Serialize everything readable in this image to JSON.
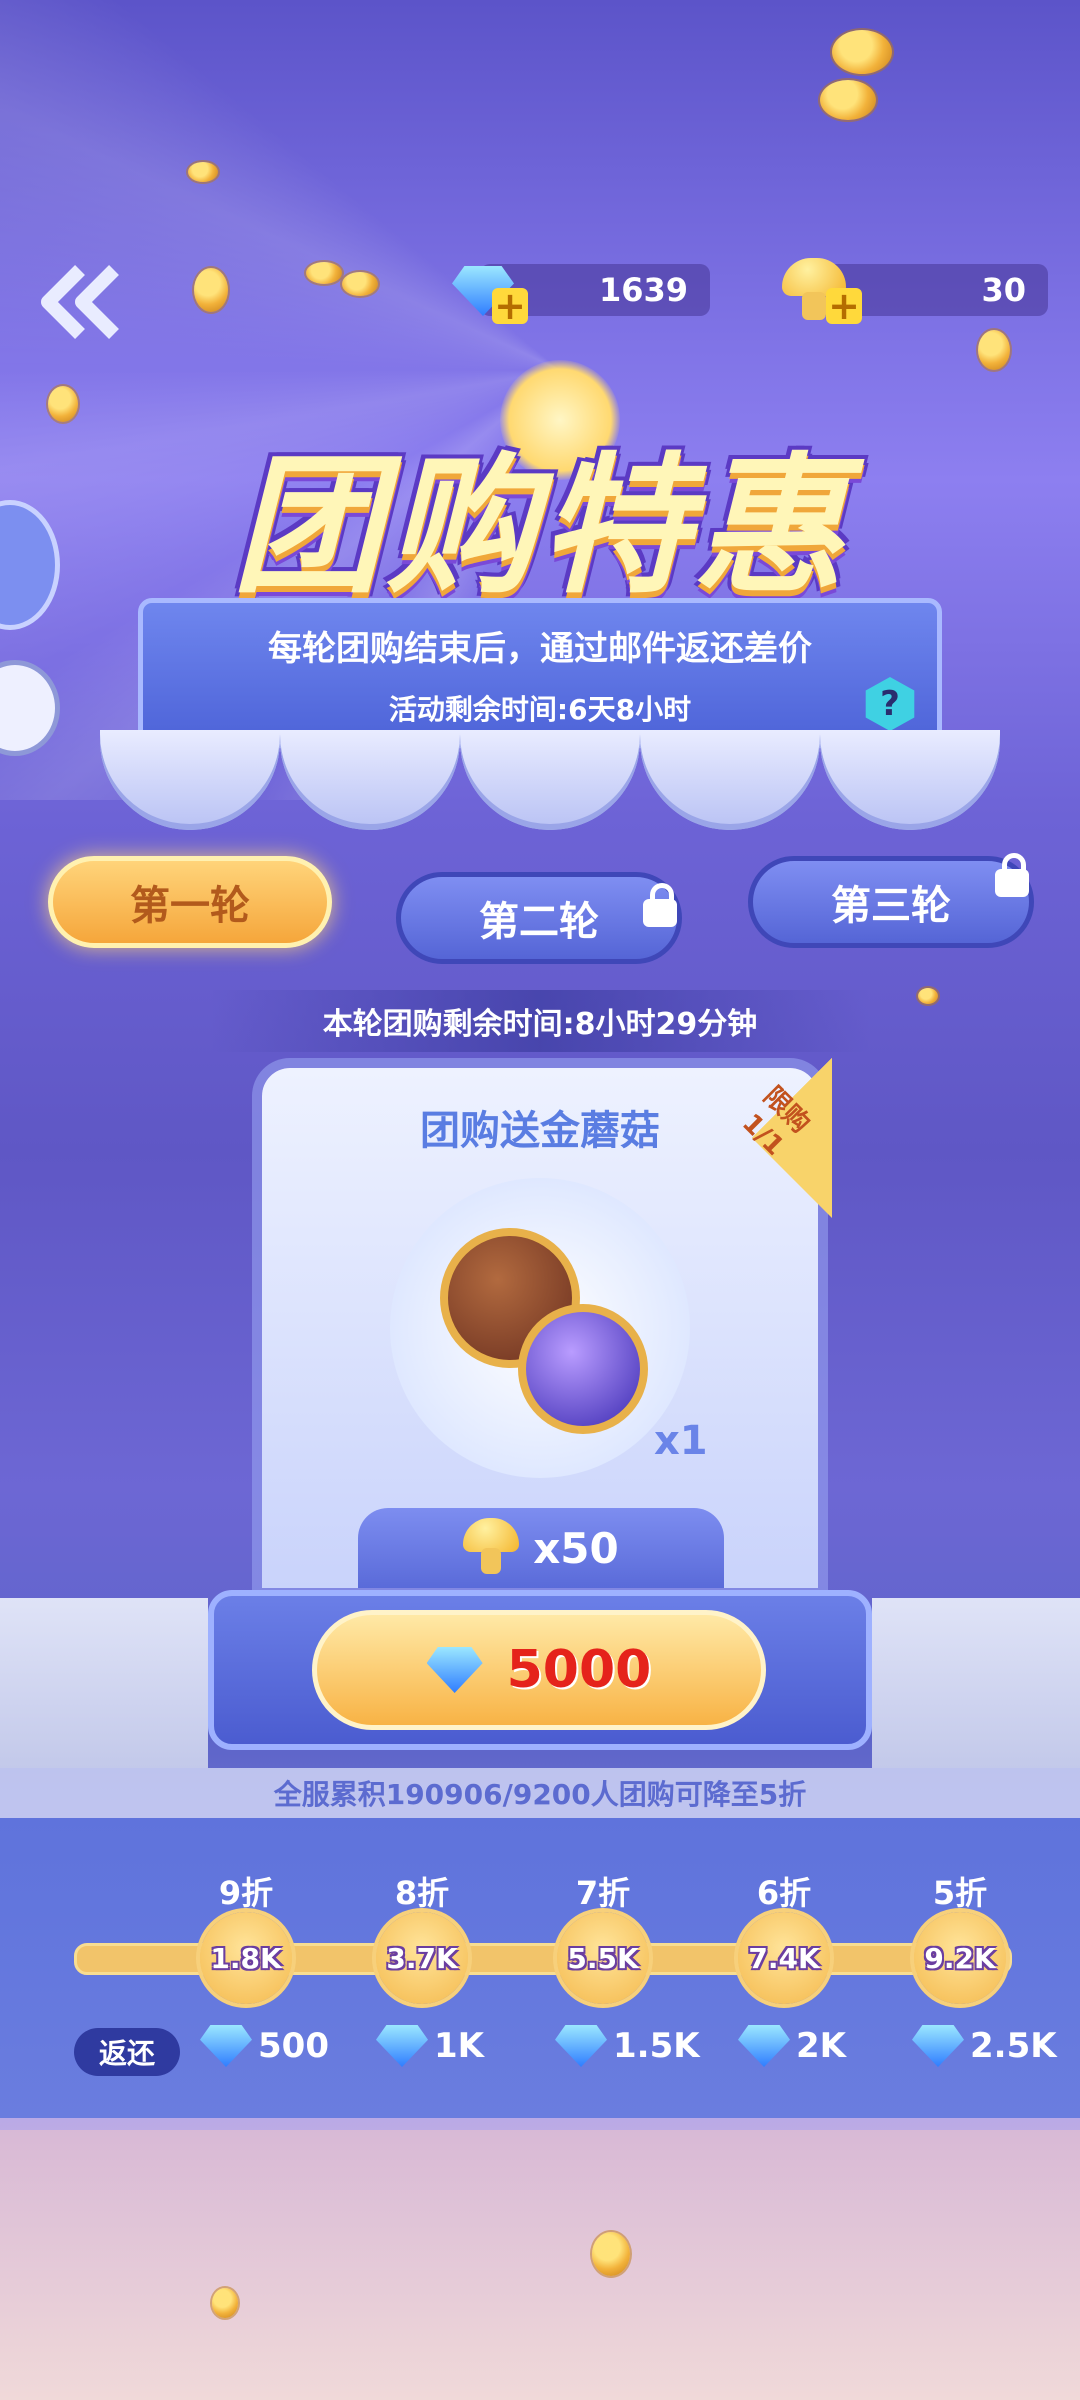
{
  "header": {
    "back_icon": "double-chevron-left-icon",
    "diamond_count": "1639",
    "mushroom_count": "30"
  },
  "banner": {
    "title": "团购特惠",
    "subtitle": "每轮团购结束后，通过邮件返还差价",
    "remaining_time": "活动剩余时间:6天8小时",
    "help_label": "?"
  },
  "rounds": {
    "tabs": [
      {
        "label": "第一轮",
        "locked": false,
        "active": true
      },
      {
        "label": "第二轮",
        "locked": true,
        "active": false
      },
      {
        "label": "第三轮",
        "locked": true,
        "active": false
      }
    ],
    "round_remaining": "本轮团购剩余时间:8小时29分钟"
  },
  "offer": {
    "title": "团购送金蘑菇",
    "limit_label": "限购",
    "limit_count": "1/1",
    "item_qty": "x1",
    "mushroom_bonus": "x50",
    "price": "5000"
  },
  "group_progress": {
    "summary": "全服累积190906/9200人团购可降至5折",
    "tiers": [
      {
        "discount": "9折",
        "threshold": "1.8K",
        "refund": "500"
      },
      {
        "discount": "8折",
        "threshold": "3.7K",
        "refund": "1K"
      },
      {
        "discount": "7折",
        "threshold": "5.5K",
        "refund": "1.5K"
      },
      {
        "discount": "6折",
        "threshold": "7.4K",
        "refund": "2K"
      },
      {
        "discount": "5折",
        "threshold": "9.2K",
        "refund": "2.5K"
      }
    ],
    "refund_label": "返还"
  },
  "colors": {
    "accent_gold": "#f5a63b",
    "price_red": "#e5231b",
    "panel_blue": "#5565d6"
  }
}
